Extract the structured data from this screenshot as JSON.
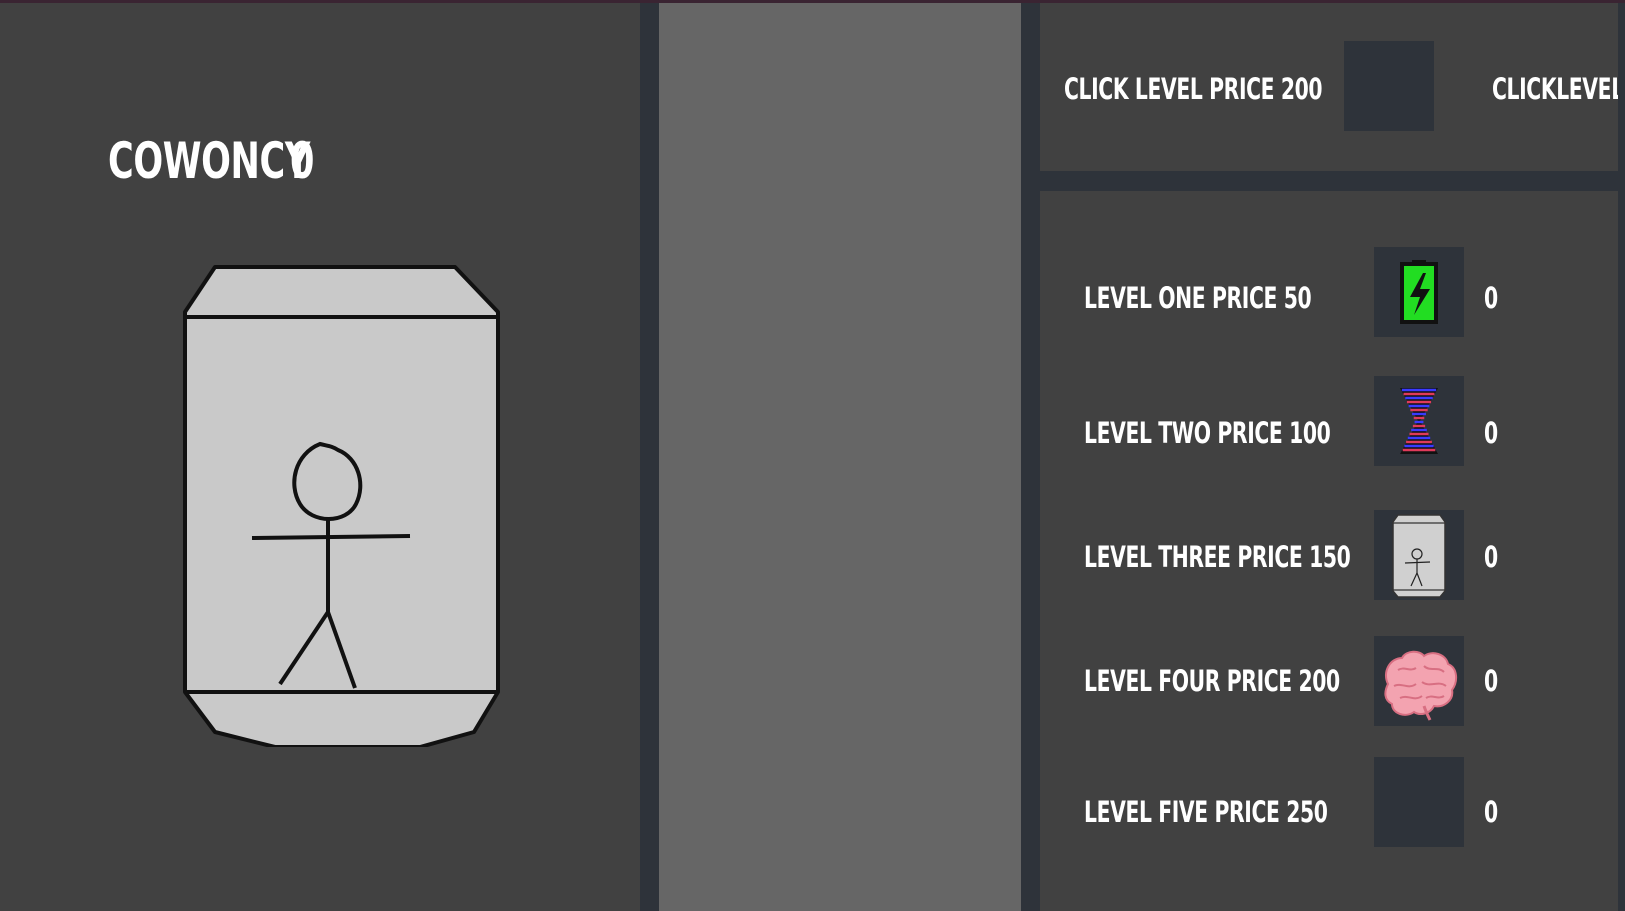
{
  "currency": {
    "label": "COWONCY",
    "value": "0"
  },
  "click_upgrade": {
    "price_text": "CLICK LEVEL PRICE  200",
    "button_label": "CLICKLEVELA"
  },
  "levels": [
    {
      "price_text": "LEVEL ONE PRICE  50",
      "count": "0",
      "icon": "battery-icon"
    },
    {
      "price_text": "LEVEL TWO PRICE 100",
      "count": "0",
      "icon": "dna-icon"
    },
    {
      "price_text": "LEVEL THREE PRICE 150",
      "count": "0",
      "icon": "can-icon"
    },
    {
      "price_text": "LEVEL FOUR PRICE 200",
      "count": "0",
      "icon": "brain-icon"
    },
    {
      "price_text": "LEVEL FIVE PRICE 250",
      "count": "0",
      "icon": ""
    }
  ],
  "colors": {
    "panel": "#414141",
    "middle_panel": "#666666",
    "frame": "#2e333a",
    "can_fill": "#c9c9c9",
    "battery_green": "#22dd22",
    "dna_blue": "#3a3aff",
    "dna_red": "#e03a5a",
    "brain_pink": "#f3a3b0"
  }
}
